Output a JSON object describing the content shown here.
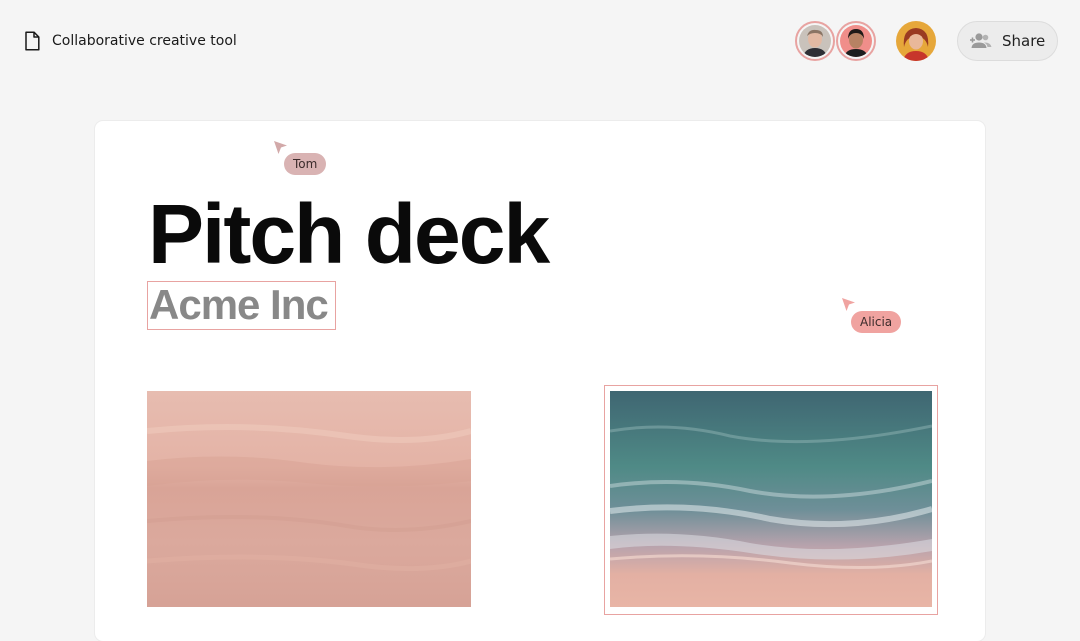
{
  "header": {
    "doc_title": "Collaborative creative tool",
    "share_label": "Share"
  },
  "collaborators": [
    {
      "name": "Tom",
      "cursor_color": "#d9b3b3"
    },
    {
      "name": "Alicia",
      "cursor_color": "#f0a3a0"
    }
  ],
  "document": {
    "title": "Pitch deck",
    "subtitle": "Acme Inc"
  },
  "icons": {
    "document": "document-icon",
    "share": "people-add-icon",
    "cursor": "cursor-arrow-icon"
  },
  "colors": {
    "selection_border": "#e8a3a1",
    "background": "#f5f5f5",
    "canvas": "#ffffff"
  }
}
